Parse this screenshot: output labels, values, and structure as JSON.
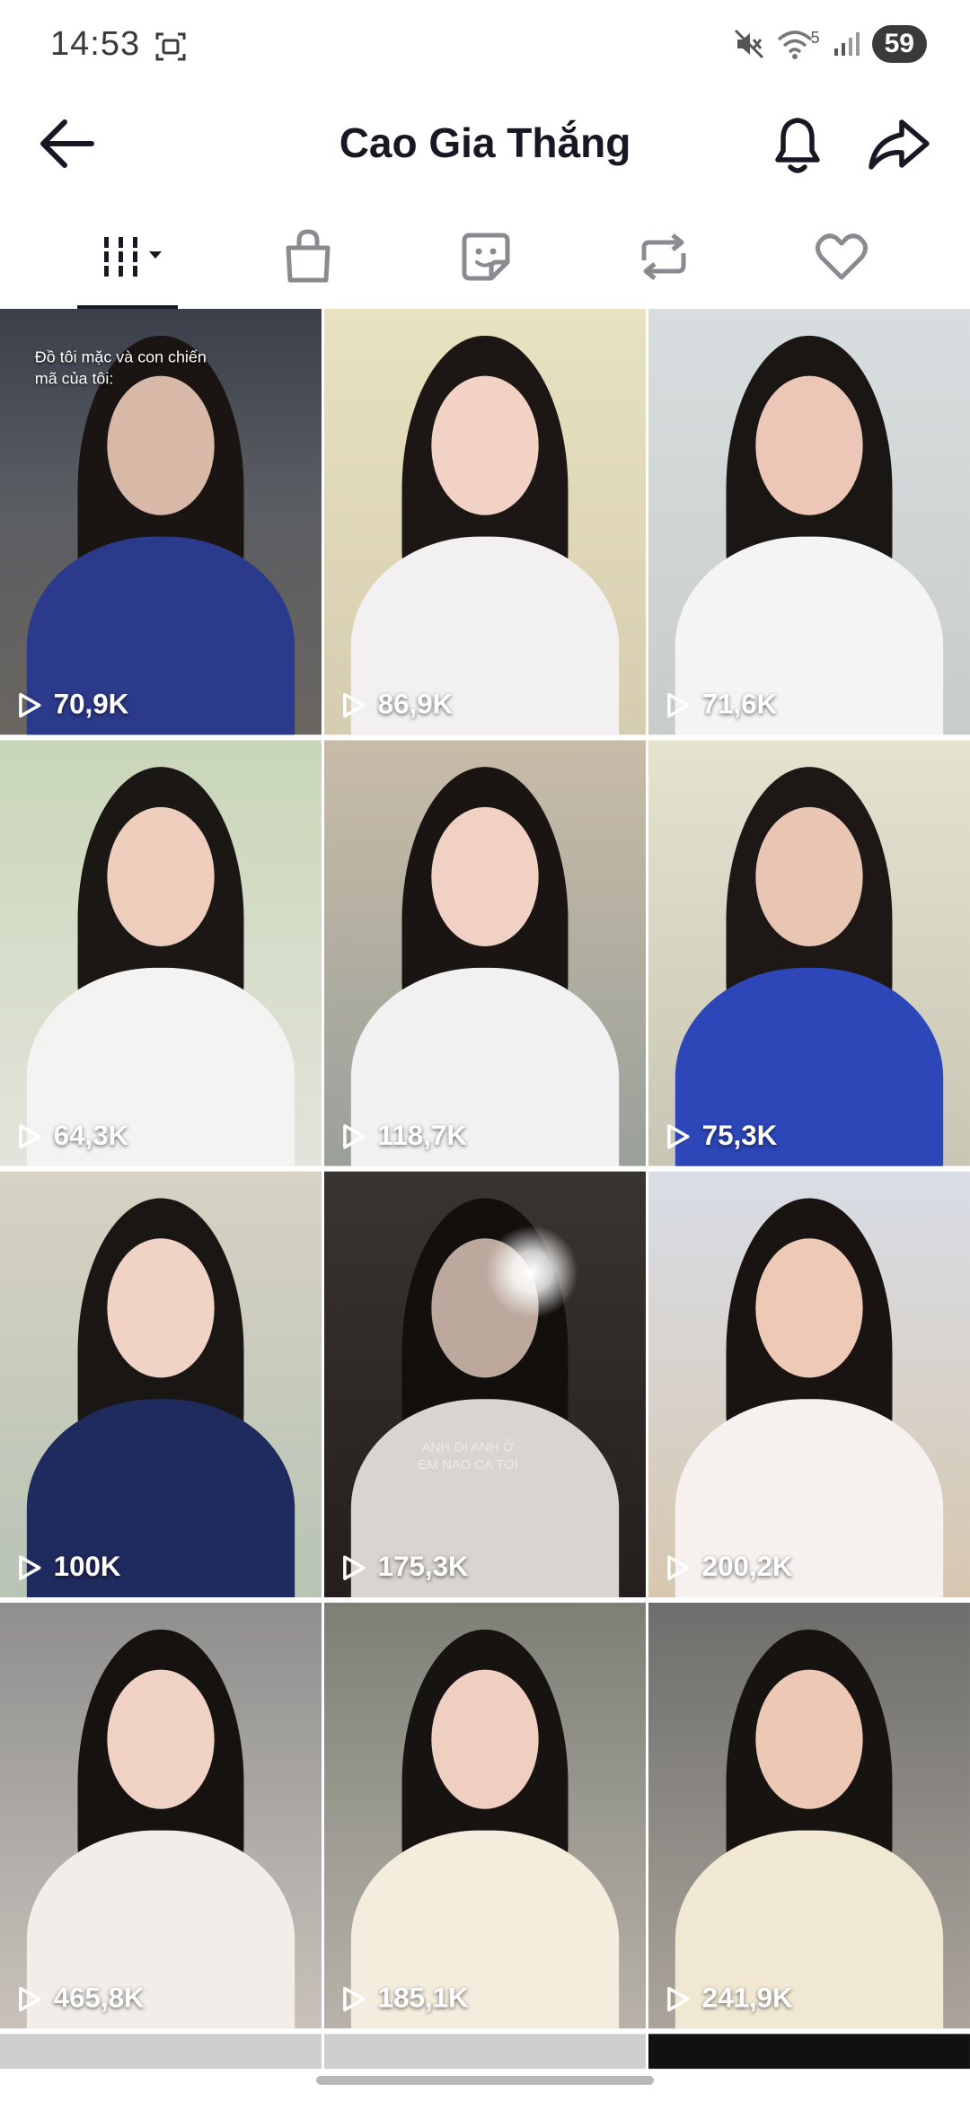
{
  "status_bar": {
    "time": "14:53",
    "battery": "59",
    "network": "5"
  },
  "header": {
    "title": "Cao Gia Thắng"
  },
  "tabs": [
    {
      "name": "videos",
      "icon": "grid-icon",
      "selected": true
    },
    {
      "name": "shop",
      "icon": "shopping-bag-icon",
      "selected": false
    },
    {
      "name": "stickers",
      "icon": "sticker-icon",
      "selected": false
    },
    {
      "name": "reposts",
      "icon": "repost-icon",
      "selected": false
    },
    {
      "name": "liked",
      "icon": "heart-icon",
      "selected": false
    }
  ],
  "videos": [
    {
      "views": "70,9K",
      "caption": "Đồ tôi mặc và con chiến\nmã của tôi:"
    },
    {
      "views": "86,9K"
    },
    {
      "views": "71,6K"
    },
    {
      "views": "64,3K"
    },
    {
      "views": "118,7K"
    },
    {
      "views": "75,3K"
    },
    {
      "views": "100K"
    },
    {
      "views": "175,3K",
      "caption": "ANH OI ANH Ở\nEM NAO CA TOI"
    },
    {
      "views": "200,2K"
    },
    {
      "views": "465,8K"
    },
    {
      "views": "185,1K"
    },
    {
      "views": "241,9K"
    }
  ],
  "colors": {
    "text_primary": "#161823",
    "accent_bg": "#ffffff",
    "battery_bg": "#3a3a3a"
  }
}
